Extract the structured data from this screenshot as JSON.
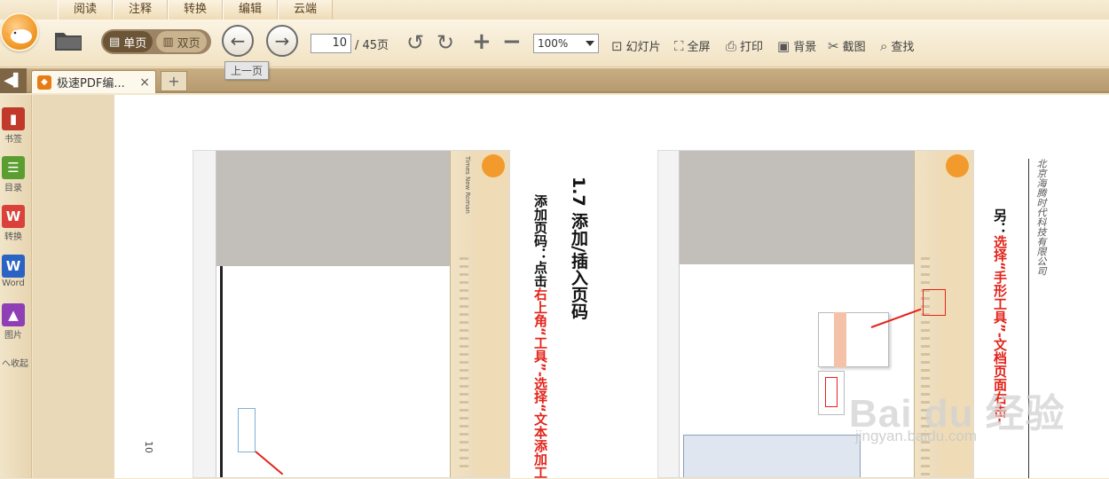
{
  "menu": {
    "tabs": [
      "阅读",
      "注释",
      "转换",
      "编辑",
      "云端"
    ]
  },
  "toolbar": {
    "single_page": "单页",
    "double_page": "双页",
    "current_page": "10",
    "total_pages": "/ 45页",
    "zoom": "100%",
    "slideshow": "幻灯片",
    "fullscreen": "全屏",
    "print": "打印",
    "background": "背景",
    "screenshot": "截图",
    "find": "查找"
  },
  "tooltip": "上一页",
  "tabbar": {
    "doc_tab": "极速PDF编...",
    "close": "×",
    "new_tab": "+"
  },
  "sidebar": {
    "items": [
      {
        "label": "书签",
        "icon": "bookmark-icon",
        "color": "#c0392b"
      },
      {
        "label": "目录",
        "icon": "toc-icon",
        "color": "#5a9e2f"
      },
      {
        "label": "转换",
        "icon": "convert-icon",
        "color": "#d9413a"
      },
      {
        "label": "Word",
        "icon": "word-icon",
        "color": "#2b63c4"
      },
      {
        "label": "图片",
        "icon": "image-icon",
        "color": "#8e3fb5"
      }
    ],
    "collapse": "へ收起"
  },
  "document": {
    "left_heading": "1.7 添加/插入页码",
    "left_line_prefix": "添加页码：点击",
    "left_line_red": "右上角“工具”-选择“文本添加工",
    "page_number": "10",
    "right_prefix": "另：",
    "right_red": "选择“手形工具”-文档页面右击-",
    "footer": "北京海腾时代科技有限公司",
    "watermark": "Bai du 经验",
    "watermark_url": "jingyan.baidu.com",
    "small_sidebar_text": "Times New Roman"
  }
}
